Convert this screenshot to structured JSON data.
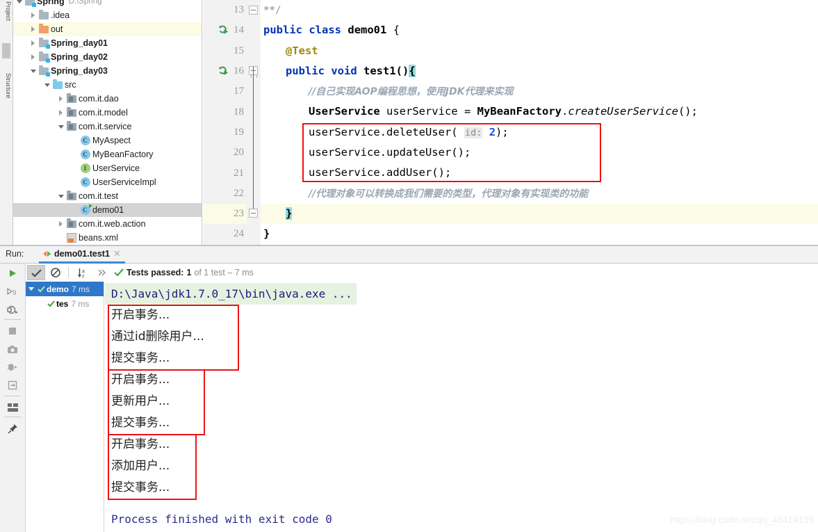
{
  "tool_strip": {
    "project_label": "Project",
    "structure_label": "Structure"
  },
  "project_tree": {
    "items": [
      {
        "label": "Spring",
        "secondary": "D:\\Spring",
        "indent": 1,
        "arrow": "down",
        "icon": "module-folder-icon",
        "bold": true,
        "state": "normal",
        "truncated_top": true
      },
      {
        "label": ".idea",
        "secondary": "",
        "indent": 2,
        "arrow": "right",
        "icon": "folder-gray-icon",
        "bold": false,
        "state": "normal"
      },
      {
        "label": "out",
        "secondary": "",
        "indent": 2,
        "arrow": "right",
        "icon": "folder-orange-icon",
        "bold": false,
        "state": "yellow"
      },
      {
        "label": "Spring_day01",
        "secondary": "",
        "indent": 2,
        "arrow": "right",
        "icon": "module-folder-icon",
        "bold": true,
        "state": "normal"
      },
      {
        "label": "Spring_day02",
        "secondary": "",
        "indent": 2,
        "arrow": "right",
        "icon": "module-folder-icon",
        "bold": true,
        "state": "normal"
      },
      {
        "label": "Spring_day03",
        "secondary": "",
        "indent": 2,
        "arrow": "down",
        "icon": "module-folder-icon",
        "bold": true,
        "state": "normal"
      },
      {
        "label": "src",
        "secondary": "",
        "indent": 3,
        "arrow": "down",
        "icon": "folder-blue-icon",
        "bold": false,
        "state": "normal"
      },
      {
        "label": "com.it.dao",
        "secondary": "",
        "indent": 4,
        "arrow": "right",
        "icon": "package-icon",
        "bold": false,
        "state": "normal"
      },
      {
        "label": "com.it.model",
        "secondary": "",
        "indent": 4,
        "arrow": "right",
        "icon": "package-icon",
        "bold": false,
        "state": "normal"
      },
      {
        "label": "com.it.service",
        "secondary": "",
        "indent": 4,
        "arrow": "down",
        "icon": "package-icon",
        "bold": false,
        "state": "normal"
      },
      {
        "label": "MyAspect",
        "secondary": "",
        "indent": 5,
        "arrow": "none",
        "icon": "class-icon",
        "bold": false,
        "state": "normal"
      },
      {
        "label": "MyBeanFactory",
        "secondary": "",
        "indent": 5,
        "arrow": "none",
        "icon": "class-icon",
        "bold": false,
        "state": "normal"
      },
      {
        "label": "UserService",
        "secondary": "",
        "indent": 5,
        "arrow": "none",
        "icon": "interface-icon",
        "bold": false,
        "state": "normal"
      },
      {
        "label": "UserServiceImpl",
        "secondary": "",
        "indent": 5,
        "arrow": "none",
        "icon": "class-icon",
        "bold": false,
        "state": "normal"
      },
      {
        "label": "com.it.test",
        "secondary": "",
        "indent": 4,
        "arrow": "down",
        "icon": "package-icon",
        "bold": false,
        "state": "normal"
      },
      {
        "label": "demo01",
        "secondary": "",
        "indent": 5,
        "arrow": "none",
        "icon": "runnable-class-icon",
        "bold": false,
        "state": "gray"
      },
      {
        "label": "com.it.web.action",
        "secondary": "",
        "indent": 4,
        "arrow": "right",
        "icon": "package-icon",
        "bold": false,
        "state": "normal"
      },
      {
        "label": "beans.xml",
        "secondary": "",
        "indent": 4,
        "arrow": "none",
        "icon": "xml-file-icon",
        "bold": false,
        "state": "normal"
      }
    ]
  },
  "editor": {
    "lines": [
      {
        "num": "13",
        "run_icon": false,
        "highlight": false
      },
      {
        "num": "14",
        "run_icon": true,
        "highlight": false
      },
      {
        "num": "15",
        "run_icon": false,
        "highlight": false
      },
      {
        "num": "16",
        "run_icon": true,
        "highlight": false
      },
      {
        "num": "17",
        "run_icon": false,
        "highlight": false
      },
      {
        "num": "18",
        "run_icon": false,
        "highlight": false
      },
      {
        "num": "19",
        "run_icon": false,
        "highlight": false
      },
      {
        "num": "20",
        "run_icon": false,
        "highlight": false
      },
      {
        "num": "21",
        "run_icon": false,
        "highlight": false
      },
      {
        "num": "22",
        "run_icon": false,
        "highlight": false
      },
      {
        "num": "23",
        "run_icon": false,
        "highlight": true
      },
      {
        "num": "24",
        "run_icon": false,
        "highlight": false
      }
    ],
    "code": {
      "l13_comment_end": "**/",
      "l14_public": "public",
      "l14_class": "class",
      "l14_name": "demo01",
      "l14_brace": "{",
      "l15_annotation": "@Test",
      "l16_public": "public",
      "l16_void": "void",
      "l16_method": "test1()",
      "l16_brace": "{",
      "l17_comment": "//自己实现AOP编程思想，使用JDK代理来实现",
      "l18_type": "UserService",
      "l18_var": " userService = ",
      "l18_factory": "MyBeanFactory",
      "l18_dot": ".",
      "l18_call": "createUserService",
      "l18_tail": "();",
      "l19_a": "userService.deleteUser( ",
      "l19_hint": "id:",
      "l19_num": " 2",
      "l19_b": ");",
      "l20": "userService.updateUser();",
      "l21": "userService.addUser();",
      "l22_comment": "//代理对象可以转换成我们需要的类型，代理对象有实现类的功能",
      "l23_brace": "}",
      "l24_brace": "}"
    }
  },
  "run_panel": {
    "run_label": "Run:",
    "tab_label": "demo01.test1",
    "tab_close": "✕",
    "toolbar": {
      "rerun_icon": "play-icon",
      "toggle_passed_icon": "checkmark-filter-icon",
      "hide_ignored_icon": "no-entry-icon",
      "sort_alpha_icon": "sort-alphabetically-icon",
      "more_icon": "chevron-double-right-icon",
      "status_check_icon": "green-check-icon",
      "status_prefix": "Tests passed:",
      "status_count": "1",
      "status_suffix": "of 1 test – 7 ms"
    },
    "side_buttons": [
      "run-play-icon",
      "rerun-failed-icon",
      "rerun-auto-icon",
      "stop-icon",
      "export-screenshot-icon",
      "debug-icon",
      "scroll-to-source-icon",
      "layout-icon",
      "pin-icon"
    ],
    "test_tree": [
      {
        "label": "demo",
        "time": "7 ms",
        "selected": true,
        "level": 0
      },
      {
        "label": "tes",
        "time": "7 ms",
        "selected": false,
        "level": 1
      }
    ],
    "console": {
      "command": "D:\\Java\\jdk1.7.0_17\\bin\\java.exe ...",
      "groups": [
        {
          "lines": [
            "开启事务...",
            "通过id删除用户...",
            "提交事务..."
          ]
        },
        {
          "lines": [
            "开启事务...",
            "更新用户...",
            "提交事务..."
          ]
        },
        {
          "lines": [
            "开启事务...",
            "添加用户...",
            "提交事务..."
          ]
        }
      ],
      "exit_line": "Process finished with exit code 0"
    }
  },
  "watermark": "https://blog.csdn.net/qq_43414199",
  "colors": {
    "accent_blue": "#2f77c9",
    "red_box": "#ee1111",
    "keyword_blue": "#0033b3",
    "green_check": "#4caf50",
    "console_text": "#2b2b8f"
  }
}
